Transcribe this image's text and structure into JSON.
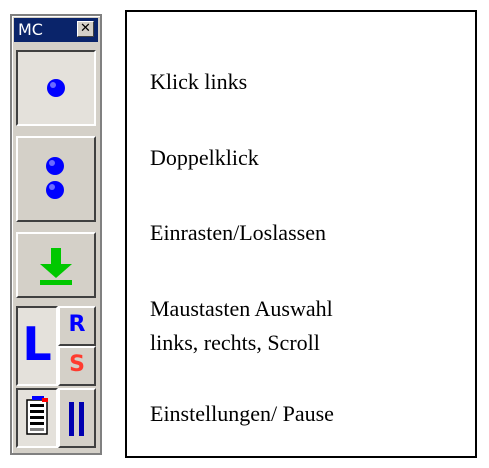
{
  "toolbar": {
    "title": "MC",
    "close_glyph": "✕",
    "buttons": [
      {
        "name": "click-left",
        "icon": "single-blue-dot-icon",
        "pressed": true
      },
      {
        "name": "double-click",
        "icon": "double-blue-dot-icon",
        "pressed": false
      },
      {
        "name": "drag-lock",
        "icon": "green-down-arrow-icon",
        "pressed": false
      },
      {
        "name": "mouse-button-select-left",
        "label": "L",
        "pressed": true
      },
      {
        "name": "mouse-button-select-right",
        "label": "R",
        "pressed": false
      },
      {
        "name": "mouse-button-select-scroll",
        "label": "S",
        "pressed": false
      },
      {
        "name": "settings",
        "icon": "settings-panel-icon",
        "pressed": true
      },
      {
        "name": "pause",
        "icon": "pause-icon",
        "pressed": false
      }
    ],
    "colors": {
      "title_bar": "#0a246a",
      "dot_blue": "#0000ff",
      "arrow_green": "#00c800",
      "letter_blue": "#0000ff",
      "letter_red": "#ff3b2f",
      "pause_blue": "#0000b0"
    }
  },
  "legend": {
    "items": [
      "Klick links",
      "Doppelklick",
      "Einrasten/Loslassen",
      "Maustasten Auswahl",
      "links, rechts, Scroll",
      "Einstellungen/ Pause"
    ]
  }
}
